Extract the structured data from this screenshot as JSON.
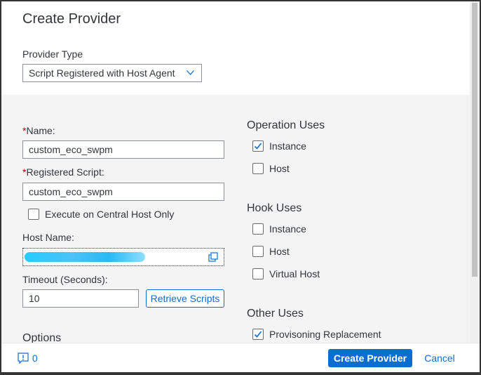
{
  "dialog": {
    "title": "Create Provider"
  },
  "provider_type": {
    "label": "Provider Type",
    "selected": "Script Registered with Host Agent"
  },
  "form": {
    "name": {
      "label": "Name:",
      "value": "custom_eco_swpm"
    },
    "registered_script": {
      "label": "Registered Script:",
      "value": "custom_eco_swpm"
    },
    "central_host": {
      "label": "Execute on Central Host Only",
      "checked": false
    },
    "host_name": {
      "label": "Host Name:",
      "value": ""
    },
    "timeout": {
      "label": "Timeout (Seconds):",
      "value": "10"
    },
    "retrieve_label": "Retrieve Scripts",
    "options_label": "Options"
  },
  "operation_uses": {
    "title": "Operation Uses",
    "items": [
      {
        "label": "Instance",
        "checked": true
      },
      {
        "label": "Host",
        "checked": false
      }
    ]
  },
  "hook_uses": {
    "title": "Hook Uses",
    "items": [
      {
        "label": "Instance",
        "checked": false
      },
      {
        "label": "Host",
        "checked": false
      },
      {
        "label": "Virtual Host",
        "checked": false
      }
    ]
  },
  "other_uses": {
    "title": "Other Uses",
    "items": [
      {
        "label": "Provisoning Replacement",
        "checked": true
      }
    ]
  },
  "footer": {
    "message_count": "0",
    "create_label": "Create Provider",
    "cancel_label": "Cancel"
  },
  "colors": {
    "accent": "#0a6ed1",
    "required": "#bb0000",
    "body_bg": "#f4f4f4"
  }
}
